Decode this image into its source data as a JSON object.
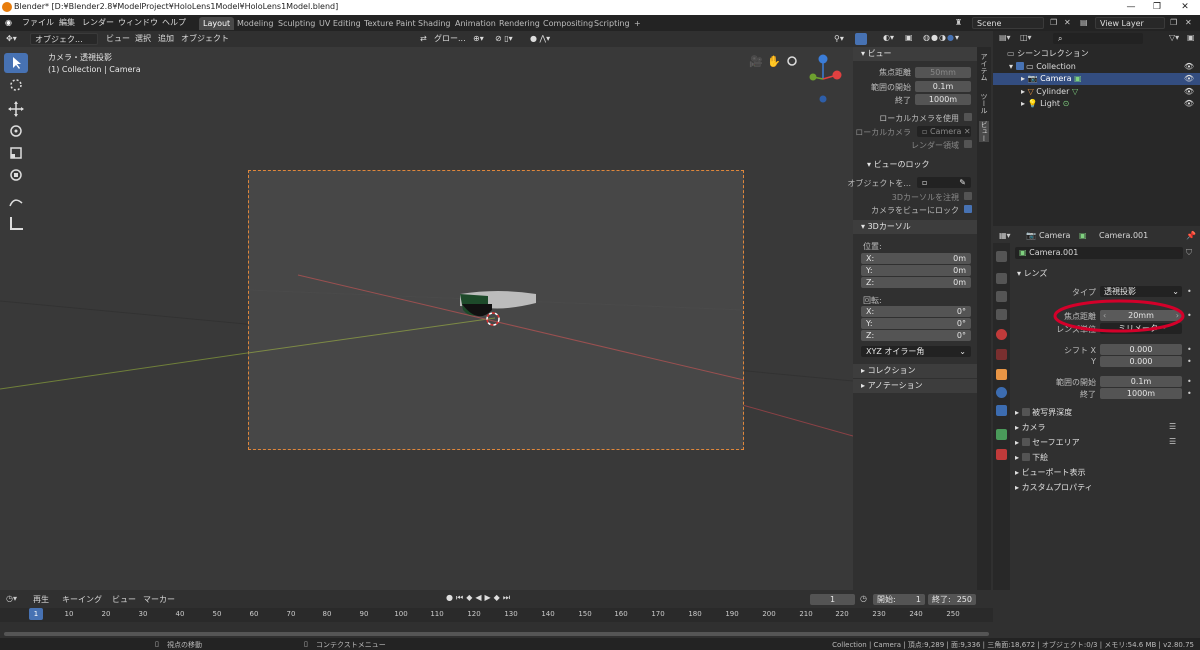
{
  "window": {
    "title": "Blender* [D:¥Blender2.8¥ModelProject¥HoloLens1Model¥HoloLens1Model.blend]",
    "minimize": "—",
    "maximize": "❐",
    "close": "✕"
  },
  "menubar": {
    "items": [
      "ファイル",
      "編集",
      "レンダー",
      "ウィンドウ",
      "ヘルプ"
    ],
    "workspaces": [
      "Layout",
      "Modeling",
      "Sculpting",
      "UV Editing",
      "Texture Paint",
      "Shading",
      "Animation",
      "Rendering",
      "Compositing",
      "Scripting",
      "+"
    ],
    "active_workspace": "Layout",
    "scene": "Scene",
    "view_layer": "View Layer"
  },
  "viewport": {
    "mode": "オブジェク...",
    "menus": [
      "ビュー",
      "選択",
      "追加",
      "オブジェクト"
    ],
    "transform": "グロー...",
    "view_name": "カメラ・透視投影",
    "collection_info": "(1) Collection | Camera"
  },
  "npanel": {
    "view_header": "ビュー",
    "focal_label": "焦点距離",
    "focal_value": "50mm",
    "clip_start_label": "範囲の開始",
    "clip_start": "0.1m",
    "clip_end_label": "終了",
    "clip_end": "1000m",
    "local_camera_use": "ローカルカメラを使用",
    "local_camera_label": "ローカルカメラ",
    "local_camera_value": "Camera",
    "render_region": "レンダー領域",
    "view_lock_header": "ビューのロック",
    "lock_object_label": "オブジェクトを...",
    "lock_3d_cursor": "3Dカーソルを注視",
    "lock_camera_to_view": "カメラをビューにロック",
    "cursor_header": "3Dカーソル",
    "location_label": "位置:",
    "loc": [
      {
        "axis": "X:",
        "value": "0m"
      },
      {
        "axis": "Y:",
        "value": "0m"
      },
      {
        "axis": "Z:",
        "value": "0m"
      }
    ],
    "rotation_label": "回転:",
    "rot": [
      {
        "axis": "X:",
        "value": "0°"
      },
      {
        "axis": "Y:",
        "value": "0°"
      },
      {
        "axis": "Z:",
        "value": "0°"
      }
    ],
    "rotation_mode": "XYZ オイラー角",
    "collection_header": "コレクション",
    "annotation_header": "アノテーション",
    "tabs": [
      "アイテム",
      "ツール",
      "ビュー"
    ]
  },
  "outliner": {
    "search_placeholder": "",
    "scene_collection": "シーンコレクション",
    "collection": "Collection",
    "objects": [
      "Camera",
      "Cylinder",
      "Light"
    ]
  },
  "properties": {
    "object": "Camera",
    "data": "Camera.001",
    "data_field": "Camera.001",
    "lens_header": "レンズ",
    "type_label": "タイプ",
    "type_value": "透視投影",
    "focal_label": "焦点距離",
    "focal_value": "20mm",
    "lens_unit_label": "レンズ単位",
    "lens_unit_value": "ミリメーター",
    "shift_x_label": "シフト X",
    "shift_x": "0.000",
    "shift_y_label": "Y",
    "shift_y": "0.000",
    "clip_start_label": "範囲の開始",
    "clip_start": "0.1m",
    "clip_end_label": "終了",
    "clip_end": "1000m",
    "sections": [
      "被写界深度",
      "カメラ",
      "セーフエリア",
      "下絵",
      "ビューポート表示",
      "カスタムプロパティ"
    ]
  },
  "timeline": {
    "menus": [
      "再生",
      "キーイング",
      "ビュー",
      "マーカー"
    ],
    "current_frame": "1",
    "start_label": "開始:",
    "start": "1",
    "end_label": "終了:",
    "end": "250",
    "ticks": [
      "1",
      "10",
      "20",
      "30",
      "40",
      "50",
      "60",
      "70",
      "80",
      "90",
      "100",
      "110",
      "120",
      "130",
      "140",
      "150",
      "160",
      "170",
      "180",
      "190",
      "200",
      "210",
      "220",
      "230",
      "240",
      "250"
    ]
  },
  "statusbar": {
    "left": "視点の移動",
    "middle": "コンテクストメニュー",
    "right": "Collection | Camera | 頂点:9,289 | 面:9,336 | 三角面:18,672 | オブジェクト:0/3 | メモリ:54.6 MB | v2.80.75"
  },
  "colors": {
    "accent": "#4772b3",
    "highlight_circle": "#d4002a",
    "camera_frame": "#e0873b"
  }
}
